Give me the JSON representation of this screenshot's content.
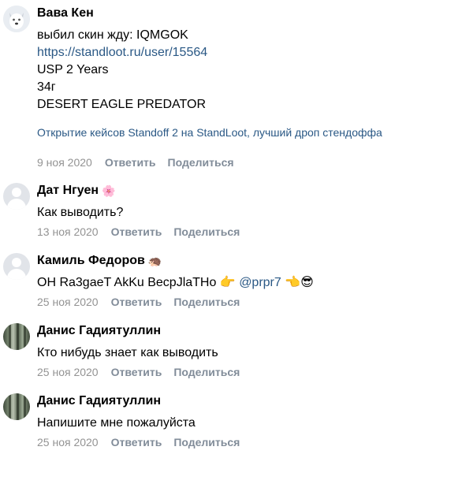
{
  "comments": [
    {
      "author": "Вава Кен",
      "author_emoji": "",
      "avatar": "dog-avatar",
      "lines": [
        "выбил скин жду: IQMGOK"
      ],
      "link": "https://standloot.ru/user/15564",
      "lines_after": [
        "USP 2 Years",
        "34г",
        "DESERT EAGLE PREDATOR"
      ],
      "preview": "Открытие кейсов Standoff 2 на StandLoot, лучший дроп стендоффа",
      "date": "9 ноя 2020",
      "reply": "Ответить",
      "share": "Поделиться"
    },
    {
      "author": "Дат Нгуен",
      "author_emoji": "🌸",
      "avatar": "default-avatar",
      "text": "Как выводить?",
      "date": "13 ноя 2020",
      "reply": "Ответить",
      "share": "Поделиться"
    },
    {
      "author": "Камиль Федоров",
      "author_emoji": "🦔",
      "avatar": "default-avatar",
      "text_before": "ОН Ra3gaeT AkKu BecpJlaTHo 👉 ",
      "mention": "@prpr7",
      "text_after": " 👈😎",
      "date": "25 ноя 2020",
      "reply": "Ответить",
      "share": "Поделиться"
    },
    {
      "author": "Данис Гадиятуллин",
      "author_emoji": "",
      "avatar": "forest-avatar",
      "text": "Кто нибудь знает как выводить",
      "date": "25 ноя 2020",
      "reply": "Ответить",
      "share": "Поделиться"
    },
    {
      "author": "Данис Гадиятуллин",
      "author_emoji": "",
      "avatar": "forest-avatar",
      "text": "Напишите мне пожалуйста",
      "date": "25 ноя 2020",
      "reply": "Ответить",
      "share": "Поделиться"
    }
  ]
}
